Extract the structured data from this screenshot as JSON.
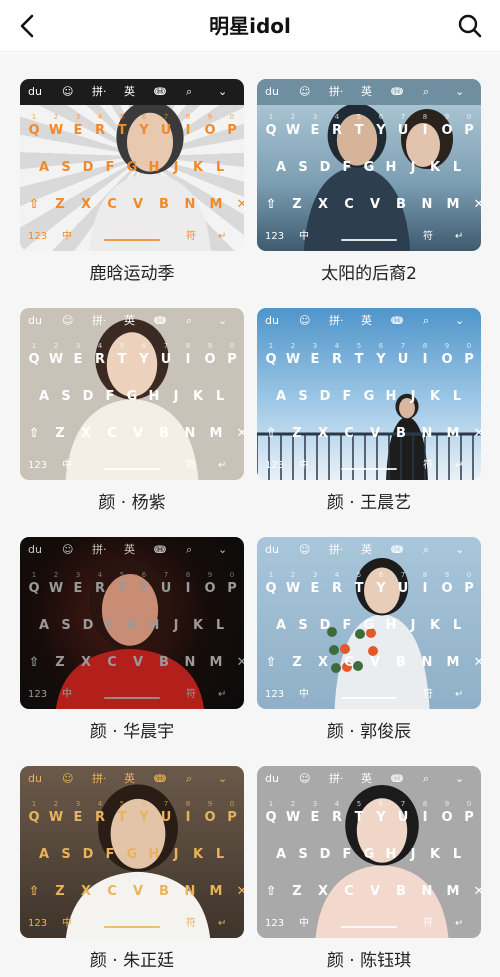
{
  "header": {
    "title": "明星idol",
    "back_icon": "chevron-left-icon",
    "search_icon": "search-icon"
  },
  "keyboard": {
    "toolbar": [
      "du",
      "☺",
      "拼·",
      "英",
      "ↈ",
      "⌕",
      "⌄"
    ],
    "digits": [
      "1",
      "2",
      "3",
      "4",
      "5",
      "6",
      "7",
      "8",
      "9",
      "0"
    ],
    "row1": [
      "Q",
      "W",
      "E",
      "R",
      "T",
      "Y",
      "U",
      "I",
      "O",
      "P"
    ],
    "row2": [
      "A",
      "S",
      "D",
      "F",
      "G",
      "H",
      "J",
      "K",
      "L"
    ],
    "row3": [
      "⇧",
      "Z",
      "X",
      "C",
      "V",
      "B",
      "N",
      "M",
      "✕"
    ],
    "bottom": [
      "123",
      "中",
      "符",
      "↵"
    ]
  },
  "skins": [
    {
      "name": "鹿晗运动季",
      "bg": "#e9e9e9",
      "key_color": "#f08a2a",
      "toolbar_color": "#ffffff",
      "toolbar_bg": "#1c1c1c",
      "accent": "#f08a2a"
    },
    {
      "name": "太阳的后裔2",
      "bg": "#8fb4c8",
      "key_color": "#ffffff",
      "toolbar_color": "#ffffff",
      "toolbar_bg": "#6f8ea0",
      "accent": "#e04a3a"
    },
    {
      "name": "颜 · 杨紫",
      "bg": "#c9c2b8",
      "key_color": "#ffffff",
      "toolbar_color": "#ffffff",
      "toolbar_bg": "transparent",
      "accent": "#ffffff"
    },
    {
      "name": "颜 · 王晨艺",
      "bg": "#5e9fd0",
      "key_color": "#ffffff",
      "toolbar_color": "#ffffff",
      "toolbar_bg": "transparent",
      "accent": "#ffffff"
    },
    {
      "name": "颜 · 华晨宇",
      "bg": "#141414",
      "key_color": "#9a9a9a",
      "toolbar_color": "#c8c8c8",
      "toolbar_bg": "transparent",
      "accent": "#c0302a"
    },
    {
      "name": "颜 · 郭俊辰",
      "bg": "#9fbcd2",
      "key_color": "#ffffff",
      "toolbar_color": "#ffffff",
      "toolbar_bg": "transparent",
      "accent": "#ffffff"
    },
    {
      "name": "颜 · 朱正廷",
      "bg": "#5b4d40",
      "key_color": "#e8b35a",
      "toolbar_color": "#e8b35a",
      "toolbar_bg": "transparent",
      "accent": "#e8b35a"
    },
    {
      "name": "颜 · 陈钰琪",
      "bg": "#a9a9a9",
      "key_color": "#ffffff",
      "toolbar_color": "#ffffff",
      "toolbar_bg": "transparent",
      "accent": "#ffffff"
    }
  ]
}
